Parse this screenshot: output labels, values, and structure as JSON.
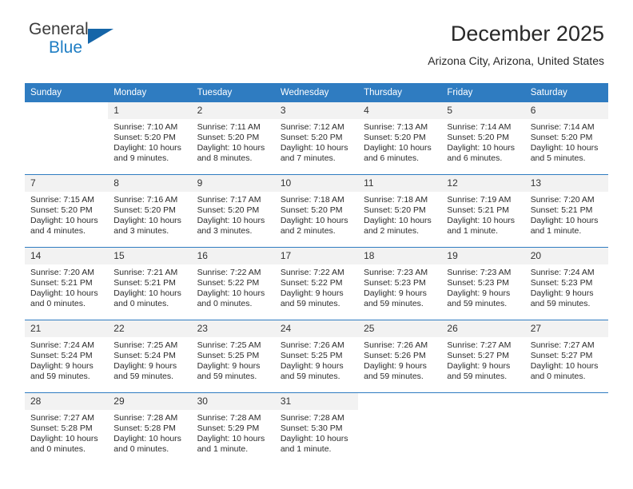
{
  "brand": {
    "name_top": "General",
    "name_bottom": "Blue",
    "accent_color": "#1f7ec4",
    "triangle_color": "#1565a8"
  },
  "header": {
    "title": "December 2025",
    "subtitle": "Arizona City, Arizona, United States",
    "header_bg": "#2f7cc1",
    "daynum_bg": "#f2f2f2"
  },
  "weekdays": [
    "Sunday",
    "Monday",
    "Tuesday",
    "Wednesday",
    "Thursday",
    "Friday",
    "Saturday"
  ],
  "labels": {
    "sunrise_prefix": "Sunrise:",
    "sunset_prefix": "Sunset:",
    "daylight_prefix": "Daylight:"
  },
  "weeks": [
    [
      {
        "day": "",
        "blank": true
      },
      {
        "day": "1",
        "sunrise": "Sunrise: 7:10 AM",
        "sunset": "Sunset: 5:20 PM",
        "daylight1": "Daylight: 10 hours",
        "daylight2": "and 9 minutes."
      },
      {
        "day": "2",
        "sunrise": "Sunrise: 7:11 AM",
        "sunset": "Sunset: 5:20 PM",
        "daylight1": "Daylight: 10 hours",
        "daylight2": "and 8 minutes."
      },
      {
        "day": "3",
        "sunrise": "Sunrise: 7:12 AM",
        "sunset": "Sunset: 5:20 PM",
        "daylight1": "Daylight: 10 hours",
        "daylight2": "and 7 minutes."
      },
      {
        "day": "4",
        "sunrise": "Sunrise: 7:13 AM",
        "sunset": "Sunset: 5:20 PM",
        "daylight1": "Daylight: 10 hours",
        "daylight2": "and 6 minutes."
      },
      {
        "day": "5",
        "sunrise": "Sunrise: 7:14 AM",
        "sunset": "Sunset: 5:20 PM",
        "daylight1": "Daylight: 10 hours",
        "daylight2": "and 6 minutes."
      },
      {
        "day": "6",
        "sunrise": "Sunrise: 7:14 AM",
        "sunset": "Sunset: 5:20 PM",
        "daylight1": "Daylight: 10 hours",
        "daylight2": "and 5 minutes."
      }
    ],
    [
      {
        "day": "7",
        "sunrise": "Sunrise: 7:15 AM",
        "sunset": "Sunset: 5:20 PM",
        "daylight1": "Daylight: 10 hours",
        "daylight2": "and 4 minutes."
      },
      {
        "day": "8",
        "sunrise": "Sunrise: 7:16 AM",
        "sunset": "Sunset: 5:20 PM",
        "daylight1": "Daylight: 10 hours",
        "daylight2": "and 3 minutes."
      },
      {
        "day": "9",
        "sunrise": "Sunrise: 7:17 AM",
        "sunset": "Sunset: 5:20 PM",
        "daylight1": "Daylight: 10 hours",
        "daylight2": "and 3 minutes."
      },
      {
        "day": "10",
        "sunrise": "Sunrise: 7:18 AM",
        "sunset": "Sunset: 5:20 PM",
        "daylight1": "Daylight: 10 hours",
        "daylight2": "and 2 minutes."
      },
      {
        "day": "11",
        "sunrise": "Sunrise: 7:18 AM",
        "sunset": "Sunset: 5:20 PM",
        "daylight1": "Daylight: 10 hours",
        "daylight2": "and 2 minutes."
      },
      {
        "day": "12",
        "sunrise": "Sunrise: 7:19 AM",
        "sunset": "Sunset: 5:21 PM",
        "daylight1": "Daylight: 10 hours",
        "daylight2": "and 1 minute."
      },
      {
        "day": "13",
        "sunrise": "Sunrise: 7:20 AM",
        "sunset": "Sunset: 5:21 PM",
        "daylight1": "Daylight: 10 hours",
        "daylight2": "and 1 minute."
      }
    ],
    [
      {
        "day": "14",
        "sunrise": "Sunrise: 7:20 AM",
        "sunset": "Sunset: 5:21 PM",
        "daylight1": "Daylight: 10 hours",
        "daylight2": "and 0 minutes."
      },
      {
        "day": "15",
        "sunrise": "Sunrise: 7:21 AM",
        "sunset": "Sunset: 5:21 PM",
        "daylight1": "Daylight: 10 hours",
        "daylight2": "and 0 minutes."
      },
      {
        "day": "16",
        "sunrise": "Sunrise: 7:22 AM",
        "sunset": "Sunset: 5:22 PM",
        "daylight1": "Daylight: 10 hours",
        "daylight2": "and 0 minutes."
      },
      {
        "day": "17",
        "sunrise": "Sunrise: 7:22 AM",
        "sunset": "Sunset: 5:22 PM",
        "daylight1": "Daylight: 9 hours",
        "daylight2": "and 59 minutes."
      },
      {
        "day": "18",
        "sunrise": "Sunrise: 7:23 AM",
        "sunset": "Sunset: 5:23 PM",
        "daylight1": "Daylight: 9 hours",
        "daylight2": "and 59 minutes."
      },
      {
        "day": "19",
        "sunrise": "Sunrise: 7:23 AM",
        "sunset": "Sunset: 5:23 PM",
        "daylight1": "Daylight: 9 hours",
        "daylight2": "and 59 minutes."
      },
      {
        "day": "20",
        "sunrise": "Sunrise: 7:24 AM",
        "sunset": "Sunset: 5:23 PM",
        "daylight1": "Daylight: 9 hours",
        "daylight2": "and 59 minutes."
      }
    ],
    [
      {
        "day": "21",
        "sunrise": "Sunrise: 7:24 AM",
        "sunset": "Sunset: 5:24 PM",
        "daylight1": "Daylight: 9 hours",
        "daylight2": "and 59 minutes."
      },
      {
        "day": "22",
        "sunrise": "Sunrise: 7:25 AM",
        "sunset": "Sunset: 5:24 PM",
        "daylight1": "Daylight: 9 hours",
        "daylight2": "and 59 minutes."
      },
      {
        "day": "23",
        "sunrise": "Sunrise: 7:25 AM",
        "sunset": "Sunset: 5:25 PM",
        "daylight1": "Daylight: 9 hours",
        "daylight2": "and 59 minutes."
      },
      {
        "day": "24",
        "sunrise": "Sunrise: 7:26 AM",
        "sunset": "Sunset: 5:25 PM",
        "daylight1": "Daylight: 9 hours",
        "daylight2": "and 59 minutes."
      },
      {
        "day": "25",
        "sunrise": "Sunrise: 7:26 AM",
        "sunset": "Sunset: 5:26 PM",
        "daylight1": "Daylight: 9 hours",
        "daylight2": "and 59 minutes."
      },
      {
        "day": "26",
        "sunrise": "Sunrise: 7:27 AM",
        "sunset": "Sunset: 5:27 PM",
        "daylight1": "Daylight: 9 hours",
        "daylight2": "and 59 minutes."
      },
      {
        "day": "27",
        "sunrise": "Sunrise: 7:27 AM",
        "sunset": "Sunset: 5:27 PM",
        "daylight1": "Daylight: 10 hours",
        "daylight2": "and 0 minutes."
      }
    ],
    [
      {
        "day": "28",
        "sunrise": "Sunrise: 7:27 AM",
        "sunset": "Sunset: 5:28 PM",
        "daylight1": "Daylight: 10 hours",
        "daylight2": "and 0 minutes."
      },
      {
        "day": "29",
        "sunrise": "Sunrise: 7:28 AM",
        "sunset": "Sunset: 5:28 PM",
        "daylight1": "Daylight: 10 hours",
        "daylight2": "and 0 minutes."
      },
      {
        "day": "30",
        "sunrise": "Sunrise: 7:28 AM",
        "sunset": "Sunset: 5:29 PM",
        "daylight1": "Daylight: 10 hours",
        "daylight2": "and 1 minute."
      },
      {
        "day": "31",
        "sunrise": "Sunrise: 7:28 AM",
        "sunset": "Sunset: 5:30 PM",
        "daylight1": "Daylight: 10 hours",
        "daylight2": "and 1 minute."
      },
      {
        "day": "",
        "blank": true
      },
      {
        "day": "",
        "blank": true
      },
      {
        "day": "",
        "blank": true
      }
    ]
  ]
}
